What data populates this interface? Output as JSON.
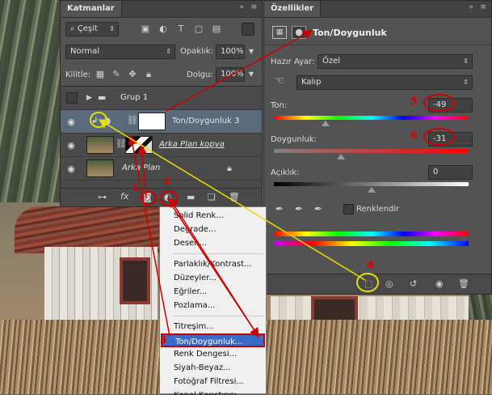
{
  "layers_panel": {
    "tab": "Katmanlar",
    "filter_kind": "Çeşit",
    "blend_mode": "Normal",
    "opacity_label": "Opaklık:",
    "opacity_value": "100%",
    "lock_label": "Kilitle:",
    "fill_label": "Dolgu:",
    "fill_value": "100%",
    "layers": [
      {
        "name": "Grup 1",
        "type": "group",
        "selected": false
      },
      {
        "name": "Ton/Doygunluk 3",
        "type": "adjustment",
        "selected": true
      },
      {
        "name": "Arka Plan kopya",
        "type": "image",
        "selected": false
      },
      {
        "name": "Arka Plan",
        "type": "image",
        "selected": false
      }
    ]
  },
  "properties_panel": {
    "tab": "Özellikler",
    "adjustment_title": "Ton/Doygunluk",
    "preset_label": "Hazır Ayar:",
    "preset_value": "Özel",
    "channel_value": "Kalıp",
    "hue_label": "Ton:",
    "hue_value": "-49",
    "saturation_label": "Doygunluk:",
    "saturation_value": "-31",
    "lightness_label": "Açıklık:",
    "lightness_value": "0",
    "colorize_label": "Renklendir"
  },
  "adjustment_menu": {
    "items": [
      "Solid Renk...",
      "Degrade...",
      "Desen...",
      "Parlaklık/Kontrast...",
      "Düzeyler...",
      "Eğriler...",
      "Pozlama...",
      "Titreşim...",
      "Ton/Doygunluk...",
      "Renk Dengesi...",
      "Siyah-Beyaz...",
      "Fotoğraf Filtresi...",
      "Kanal Karıştırıcı..."
    ],
    "highlighted_index": 8
  },
  "annotations": {
    "step1": "1",
    "step2": "2",
    "step3": "3",
    "step4": "4",
    "step5": "5",
    "step6": "6"
  },
  "colors": {
    "annotation_red": "#d00000",
    "annotation_yellow": "#e8e000",
    "panel_bg": "#535353",
    "selection_blue": "#3a6bc9"
  }
}
